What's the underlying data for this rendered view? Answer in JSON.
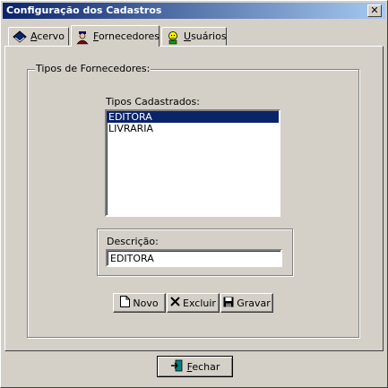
{
  "window": {
    "title": "Configuração dos Cadastros",
    "close_glyph": "✕"
  },
  "tabs": [
    {
      "label_first": "A",
      "label_rest": "cervo",
      "icon": "book-icon"
    },
    {
      "label_first": "F",
      "label_rest": "ornecedores",
      "icon": "supplier-person-icon",
      "active": true
    },
    {
      "label_first": "U",
      "label_rest": "suários",
      "icon": "users-icon"
    }
  ],
  "group": {
    "label": "Tipos de Fornecedores:"
  },
  "list": {
    "label": "Tipos Cadastrados:",
    "items": [
      "EDITORA",
      "LIVRARIA"
    ],
    "selected_index": 0
  },
  "description": {
    "label": "Descrição:",
    "value": "EDITORA"
  },
  "buttons": {
    "novo": "Novo",
    "excluir": "Excluir",
    "gravar": "Gravar",
    "fechar_first": "F",
    "fechar_rest": "echar"
  },
  "colors": {
    "selection": "#0a246a",
    "face": "#d4d0c8",
    "title_start": "#0a246a",
    "title_end": "#a6caf0"
  }
}
